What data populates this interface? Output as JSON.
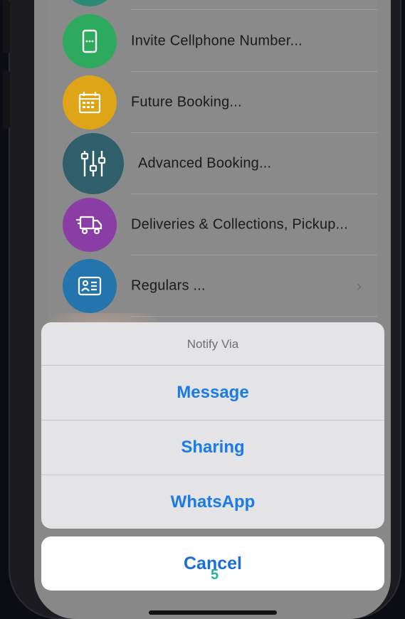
{
  "menu": {
    "items": [
      {
        "label": "Invite Cellphone Number...",
        "icon": "cellphone-icon",
        "color": "#2daa5e",
        "chevron": ""
      },
      {
        "label": "Future Booking...",
        "icon": "calendar-icon",
        "color": "#e0a516",
        "chevron": ""
      },
      {
        "label": "Advanced Booking...",
        "icon": "sliders-icon",
        "color": "#2f5f6a",
        "chevron": ""
      },
      {
        "label": "Deliveries & Collections, Pickup...",
        "icon": "delivery-truck-icon",
        "color": "#8b3da6",
        "chevron": ""
      },
      {
        "label": "Regulars ...",
        "icon": "id-card-icon",
        "color": "#2474ad",
        "chevron": "›"
      }
    ]
  },
  "action_sheet": {
    "title": "Notify Via",
    "options": [
      "Message",
      "Sharing",
      "WhatsApp"
    ],
    "cancel_label": "Cancel"
  },
  "overlay": {
    "step_number": "5"
  },
  "colors": {
    "accent": "#1a7ae6",
    "sheet_bg": "#e4e4e6",
    "step": "#2ab09a"
  }
}
